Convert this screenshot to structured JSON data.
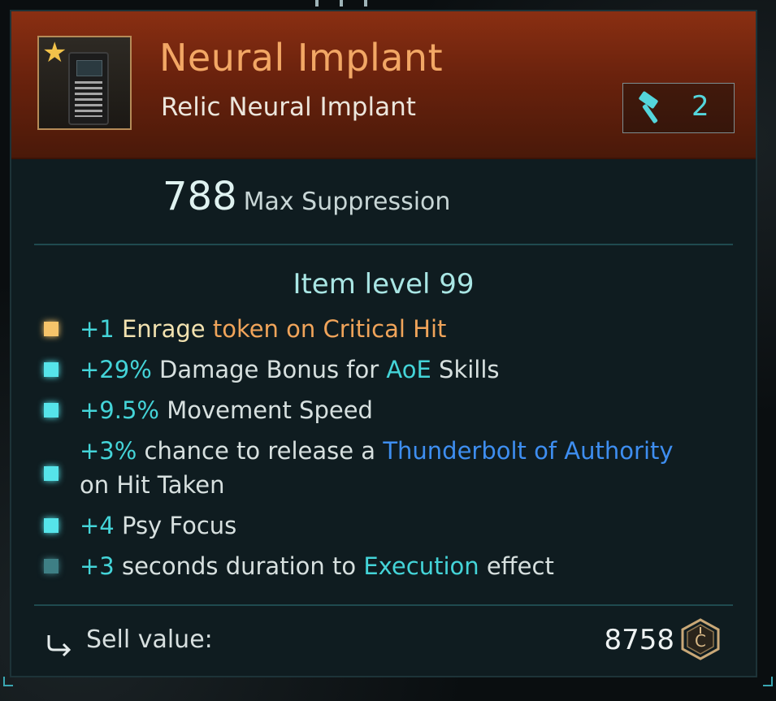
{
  "item": {
    "name": "Neural Implant",
    "subtitle": "Relic Neural Implant",
    "tier": "2",
    "icon": "neural-implant-icon",
    "rarity_star": "★"
  },
  "primary_stat": {
    "value": "788",
    "label": "Max Suppression"
  },
  "item_level": "Item level 99",
  "affixes": [
    {
      "bullet": "gold",
      "parts": [
        [
          "+1",
          "cyan"
        ],
        [
          " Enrage",
          "cream"
        ],
        [
          " token on Critical Hit",
          "gold"
        ]
      ]
    },
    {
      "bullet": "cyan",
      "parts": [
        [
          "+29%",
          "cyan"
        ],
        [
          " Damage Bonus for ",
          "plain"
        ],
        [
          "AoE",
          "cyan"
        ],
        [
          " Skills",
          "plain"
        ]
      ]
    },
    {
      "bullet": "cyan",
      "parts": [
        [
          "+9.5%",
          "cyan"
        ],
        [
          " Movement Speed",
          "plain"
        ]
      ]
    },
    {
      "bullet": "cyan",
      "line1": [
        [
          "+3%",
          "cyan"
        ],
        [
          " chance to release a ",
          "plain"
        ],
        [
          "Thunderbolt of Authority",
          "blue"
        ]
      ],
      "line2": [
        [
          "on Hit Taken",
          "plain"
        ]
      ]
    },
    {
      "bullet": "cyan",
      "parts": [
        [
          "+4",
          "cyan"
        ],
        [
          " Psy Focus",
          "plain"
        ]
      ]
    },
    {
      "bullet": "dim",
      "parts": [
        [
          "+3",
          "cyan"
        ],
        [
          " seconds duration to ",
          "plain"
        ],
        [
          "Execution",
          "cyan"
        ],
        [
          " effect",
          "plain"
        ]
      ]
    }
  ],
  "sell": {
    "label": "Sell value:",
    "value": "8758",
    "icon": "credit-coin-icon"
  },
  "colors": {
    "header_orange": "#8a2f12",
    "title_orange": "#f2a765",
    "cyan": "#44d4d8",
    "gold": "#f0a45a",
    "blue": "#3e8ef0"
  }
}
